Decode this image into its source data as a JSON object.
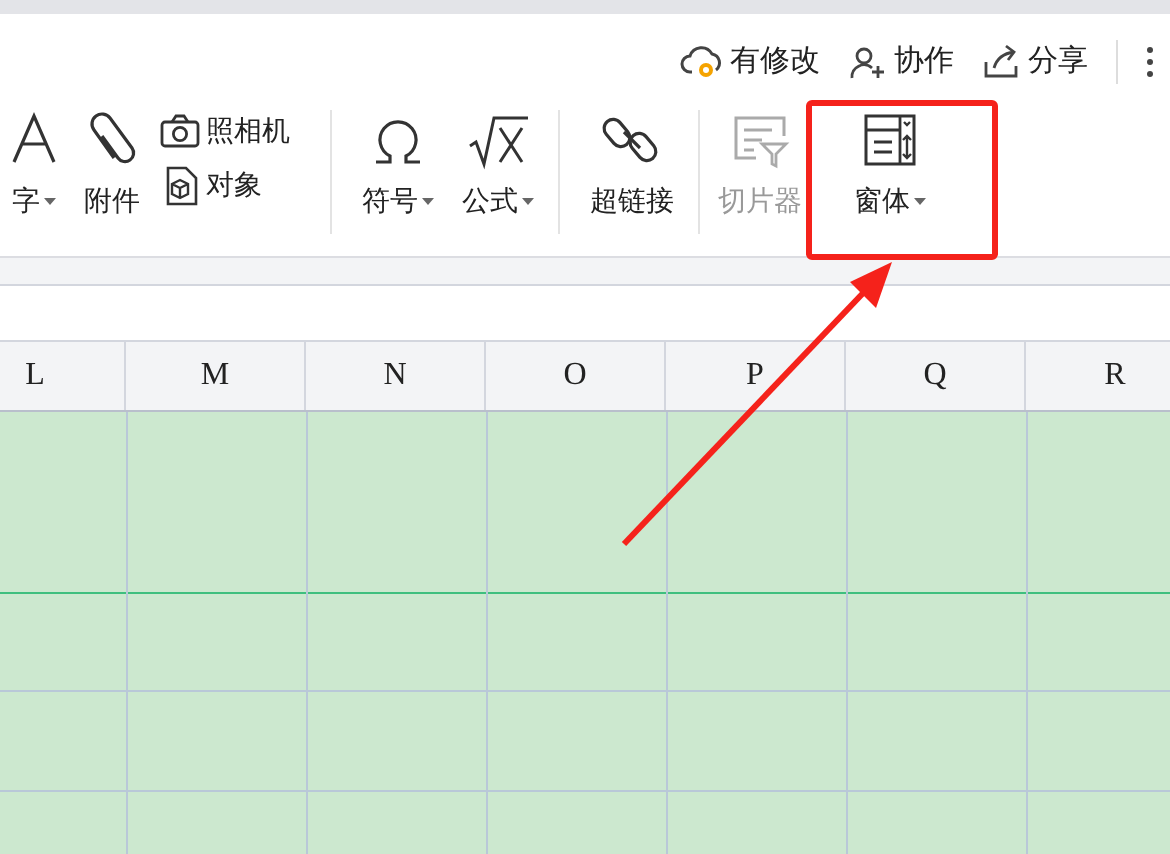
{
  "header_actions": [
    {
      "kind": "cloud",
      "label": "有修改"
    },
    {
      "kind": "collab",
      "label": "协作"
    },
    {
      "kind": "share",
      "label": "分享"
    }
  ],
  "ribbon": {
    "groups": [
      [
        {
          "kind": "large",
          "label": "字",
          "dropdown": true,
          "disabled": false
        },
        {
          "kind": "large",
          "label": "附件",
          "dropdown": false,
          "disabled": false
        },
        {
          "kind": "stack",
          "items": [
            {
              "label": "照相机"
            },
            {
              "label": "对象"
            }
          ]
        }
      ],
      [
        {
          "kind": "large",
          "label": "符号",
          "dropdown": true,
          "disabled": false
        },
        {
          "kind": "large",
          "label": "公式",
          "dropdown": true,
          "disabled": false
        }
      ],
      [
        {
          "kind": "large",
          "label": "超链接",
          "dropdown": false,
          "disabled": false
        }
      ],
      [
        {
          "kind": "large",
          "label": "切片器",
          "dropdown": false,
          "disabled": true
        },
        {
          "kind": "large",
          "label": "窗体",
          "dropdown": true,
          "disabled": false
        }
      ]
    ]
  },
  "columns": [
    "L",
    "M",
    "N",
    "O",
    "P",
    "Q",
    "R"
  ]
}
